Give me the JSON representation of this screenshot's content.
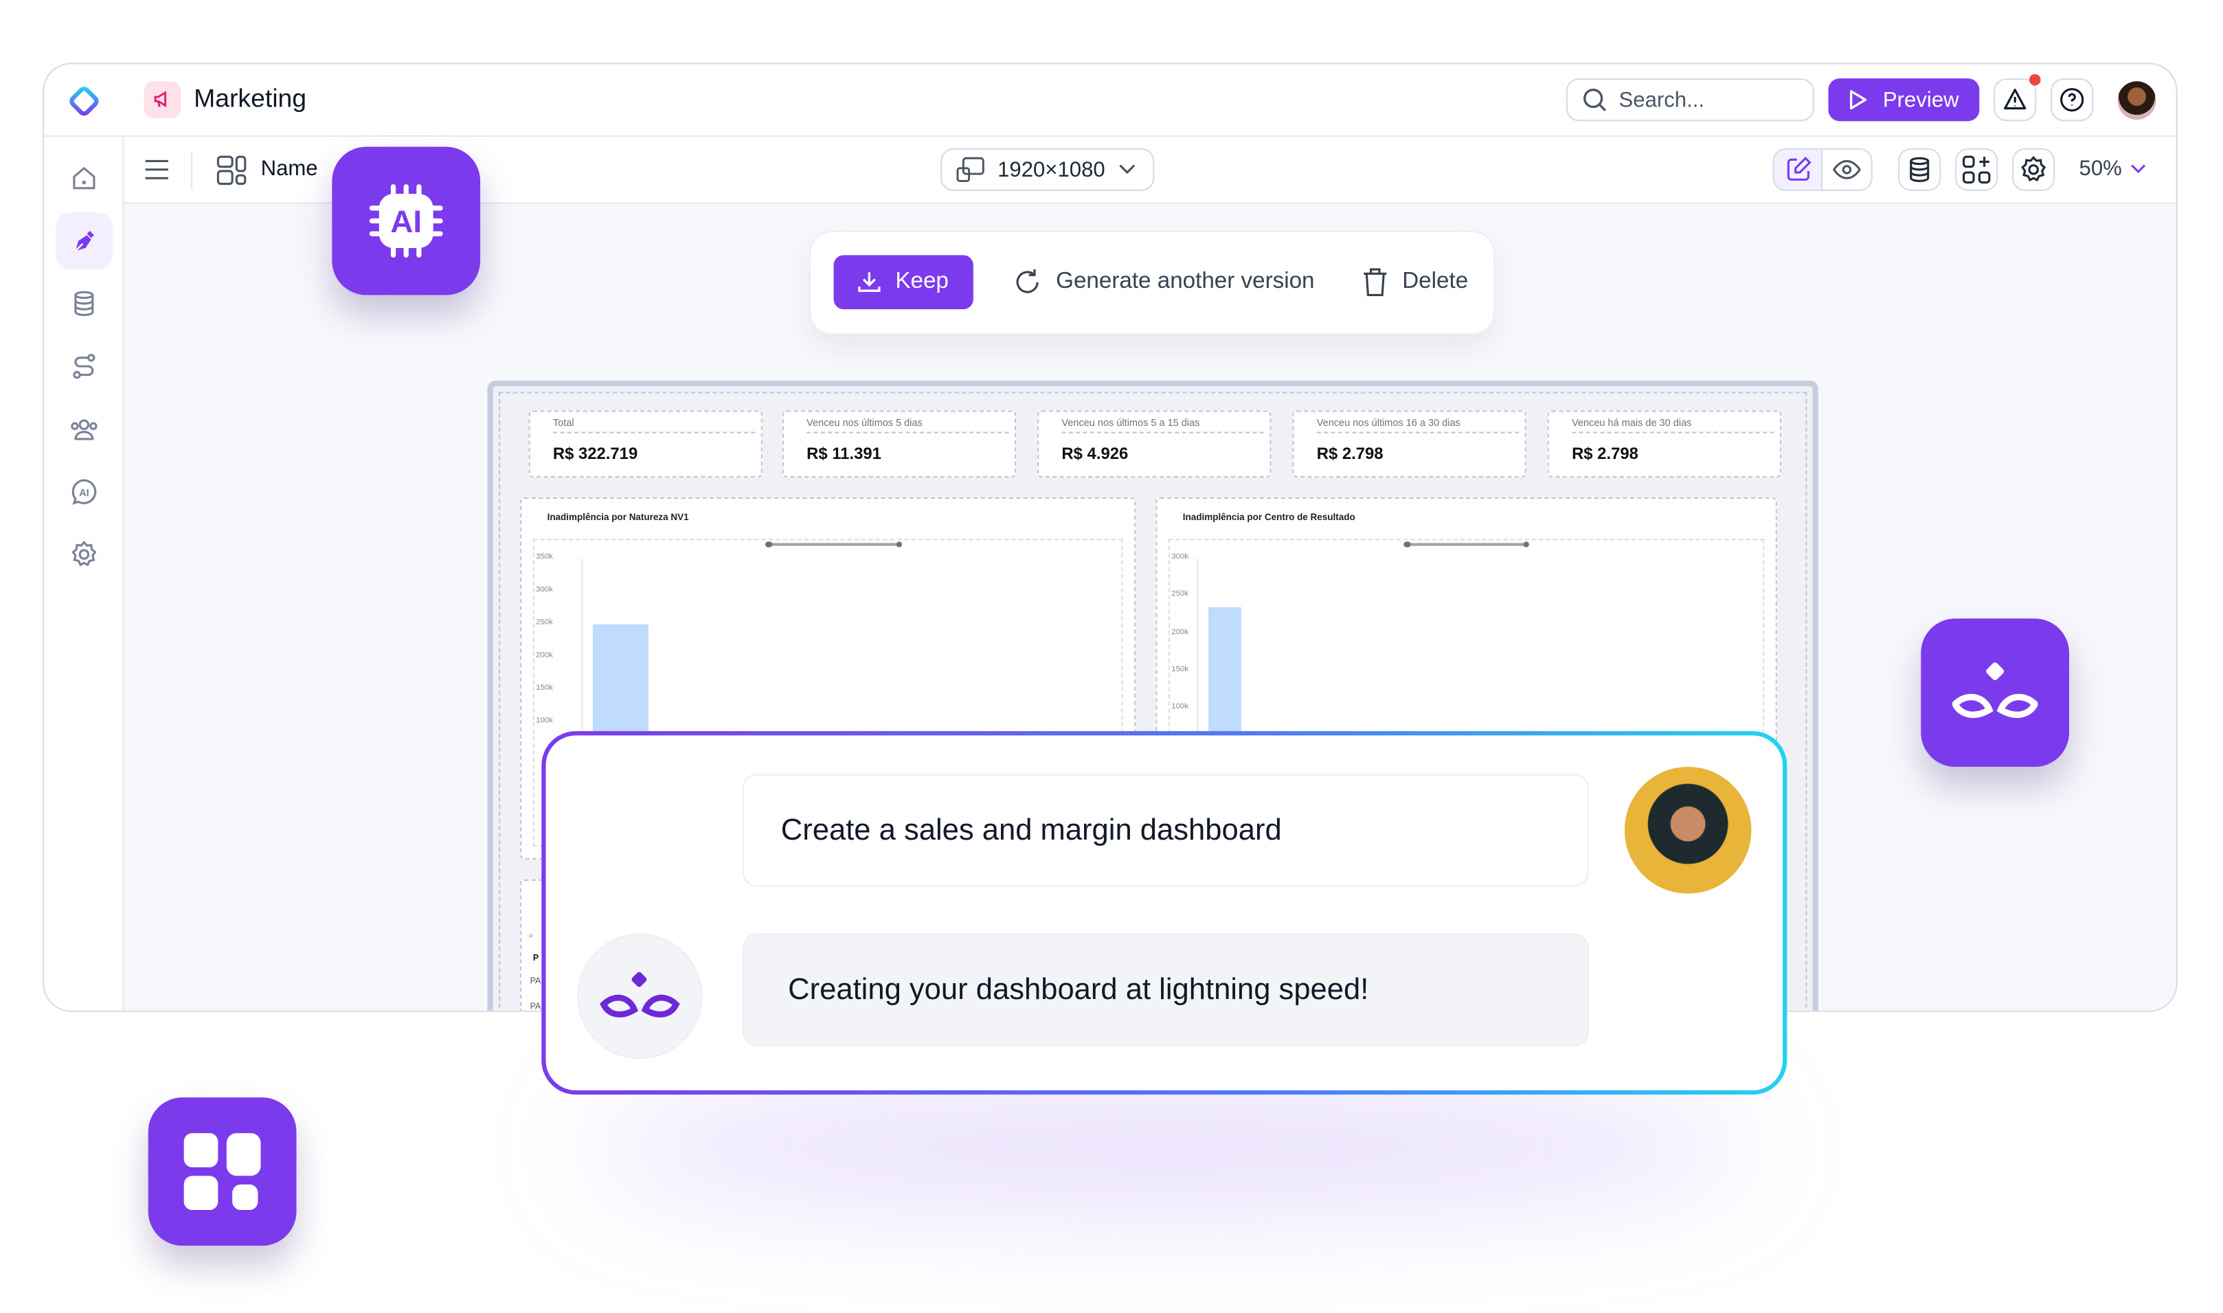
{
  "header": {
    "title": "Marketing",
    "search_placeholder": "Search...",
    "preview_label": "Preview",
    "accent": "#7c3aed",
    "notification_dot": "#ef4444"
  },
  "toolbar": {
    "name_label": "Name",
    "resolution": "1920×1080",
    "zoom": "50%"
  },
  "sidebar": {
    "items": [
      {
        "icon": "home-icon"
      },
      {
        "icon": "pen-tool-icon",
        "active": true
      },
      {
        "icon": "database-icon"
      },
      {
        "icon": "route-icon"
      },
      {
        "icon": "users-icon"
      },
      {
        "icon": "ai-chat-icon"
      },
      {
        "icon": "settings-icon"
      }
    ]
  },
  "ai_tile": {
    "label": "AI"
  },
  "action_bar": {
    "keep": "Keep",
    "generate": "Generate another version",
    "delete": "Delete"
  },
  "dashboard": {
    "kpis": [
      {
        "label": "Total",
        "value": "R$ 322.719"
      },
      {
        "label": "Venceu nos últimos 5 dias",
        "value": "R$ 11.391"
      },
      {
        "label": "Venceu nos últimos 5 a 15 dias",
        "value": "R$ 4.926"
      },
      {
        "label": "Venceu nos últimos 16 a 30 dias",
        "value": "R$ 2.798"
      },
      {
        "label": "Venceu há mais de 30 dias",
        "value": "R$ 2.798"
      }
    ],
    "table_peek": {
      "header": "P",
      "rows": [
        "PA",
        "PA"
      ]
    }
  },
  "chart_data": [
    {
      "type": "bar",
      "title": "Inadimplência por Natureza NV1",
      "yticks": [
        "350k",
        "300k",
        "250k",
        "200k",
        "150k",
        "100k"
      ],
      "ylim": [
        100000,
        350000
      ],
      "values": [
        250000
      ],
      "color": "#bfdbfe"
    },
    {
      "type": "bar",
      "title": "Inadimplência por Centro de Resultado",
      "yticks": [
        "300k",
        "250k",
        "200k",
        "150k",
        "100k"
      ],
      "ylim": [
        100000,
        300000
      ],
      "values": [
        236000
      ],
      "color": "#bfdbfe"
    }
  ],
  "chat": {
    "user_message": "Create a sales and margin dashboard",
    "bot_message": "Creating your dashboard at lightning speed!"
  }
}
